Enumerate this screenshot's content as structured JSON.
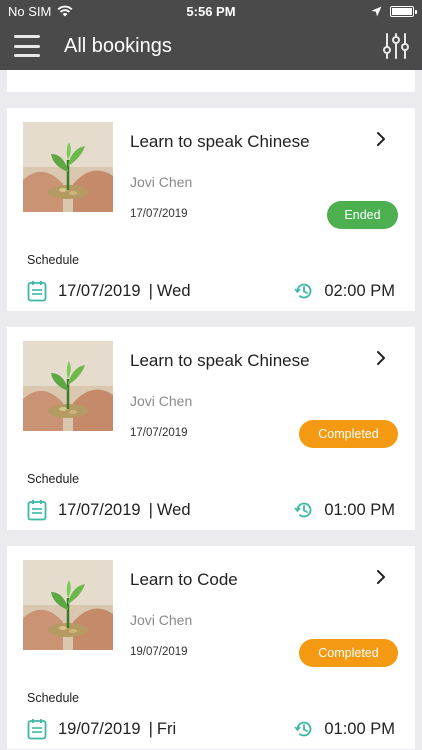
{
  "status_bar": {
    "carrier": "No SIM",
    "time": "5:56 PM"
  },
  "header": {
    "title": "All bookings"
  },
  "colors": {
    "header_bg": "#4a4a4a",
    "accent_teal": "#3bb8a6",
    "badge_ended": "#4caf50",
    "badge_completed": "#f39a12"
  },
  "bookings": [
    {
      "title": "Learn to speak Chinese",
      "teacher": "Jovi Chen",
      "date": "17/07/2019",
      "status": "Ended",
      "schedule_label": "Schedule",
      "schedule_date": "17/07/2019",
      "separator": "|",
      "schedule_day": "Wed",
      "schedule_time": "02:00 PM"
    },
    {
      "title": "Learn to speak Chinese",
      "teacher": "Jovi Chen",
      "date": "17/07/2019",
      "status": "Completed",
      "schedule_label": "Schedule",
      "schedule_date": "17/07/2019",
      "separator": "|",
      "schedule_day": "Wed",
      "schedule_time": "01:00 PM"
    },
    {
      "title": "Learn to Code",
      "teacher": "Jovi Chen",
      "date": "19/07/2019",
      "status": "Completed",
      "schedule_label": "Schedule",
      "schedule_date": "19/07/2019",
      "separator": "|",
      "schedule_day": "Fri",
      "schedule_time": "01:00 PM"
    }
  ]
}
